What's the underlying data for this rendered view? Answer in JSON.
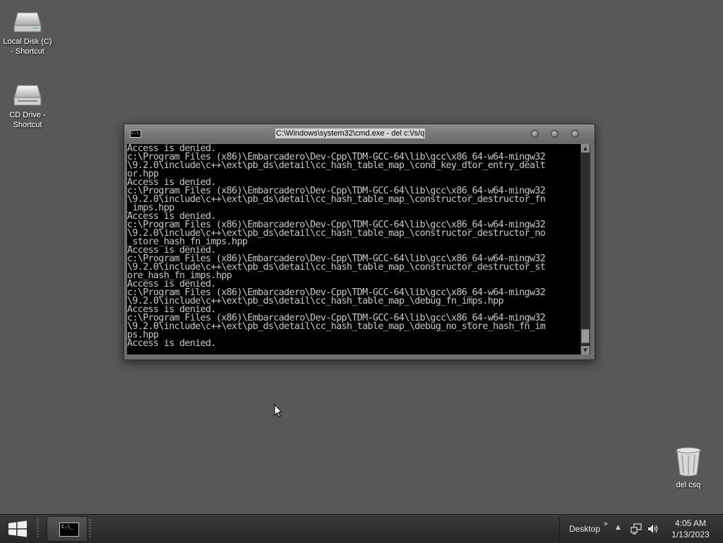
{
  "desktop": {
    "icons": [
      {
        "label": "Local Disk (C)\n- Shortcut",
        "icon": "hard-drive-icon"
      },
      {
        "label": "CD Drive -\nShortcut",
        "icon": "cd-drive-icon"
      },
      {
        "label": "del csq",
        "icon": "recycle-bin-icon"
      }
    ]
  },
  "window": {
    "title": "C:\\Windows\\system32\\cmd.exe - del  c:\\/s/q",
    "console_lines": [
      "Access is denied.",
      "c:\\Program Files (x86)\\Embarcadero\\Dev-Cpp\\TDM-GCC-64\\lib\\gcc\\x86_64-w64-mingw32",
      "\\9.2.0\\include\\c++\\ext\\pb_ds\\detail\\cc_hash_table_map_\\cond_key_dtor_entry_dealt",
      "or.hpp",
      "Access is denied.",
      "c:\\Program Files (x86)\\Embarcadero\\Dev-Cpp\\TDM-GCC-64\\lib\\gcc\\x86_64-w64-mingw32",
      "\\9.2.0\\include\\c++\\ext\\pb_ds\\detail\\cc_hash_table_map_\\constructor_destructor_fn",
      "_imps.hpp",
      "Access is denied.",
      "c:\\Program Files (x86)\\Embarcadero\\Dev-Cpp\\TDM-GCC-64\\lib\\gcc\\x86_64-w64-mingw32",
      "\\9.2.0\\include\\c++\\ext\\pb_ds\\detail\\cc_hash_table_map_\\constructor_destructor_no",
      "_store_hash_fn_imps.hpp",
      "Access is denied.",
      "c:\\Program Files (x86)\\Embarcadero\\Dev-Cpp\\TDM-GCC-64\\lib\\gcc\\x86_64-w64-mingw32",
      "\\9.2.0\\include\\c++\\ext\\pb_ds\\detail\\cc_hash_table_map_\\constructor_destructor_st",
      "ore_hash_fn_imps.hpp",
      "Access is denied.",
      "c:\\Program Files (x86)\\Embarcadero\\Dev-Cpp\\TDM-GCC-64\\lib\\gcc\\x86_64-w64-mingw32",
      "\\9.2.0\\include\\c++\\ext\\pb_ds\\detail\\cc_hash_table_map_\\debug_fn_imps.hpp",
      "Access is denied.",
      "c:\\Program Files (x86)\\Embarcadero\\Dev-Cpp\\TDM-GCC-64\\lib\\gcc\\x86_64-w64-mingw32",
      "\\9.2.0\\include\\c++\\ext\\pb_ds\\detail\\cc_hash_table_map_\\debug_no_store_hash_fn_im",
      "ps.hpp",
      "Access is denied."
    ]
  },
  "taskbar": {
    "desktop_label": "Desktop",
    "time": "4:05 AM",
    "date": "1/13/2023",
    "task_icon_text": "C:\\_"
  }
}
